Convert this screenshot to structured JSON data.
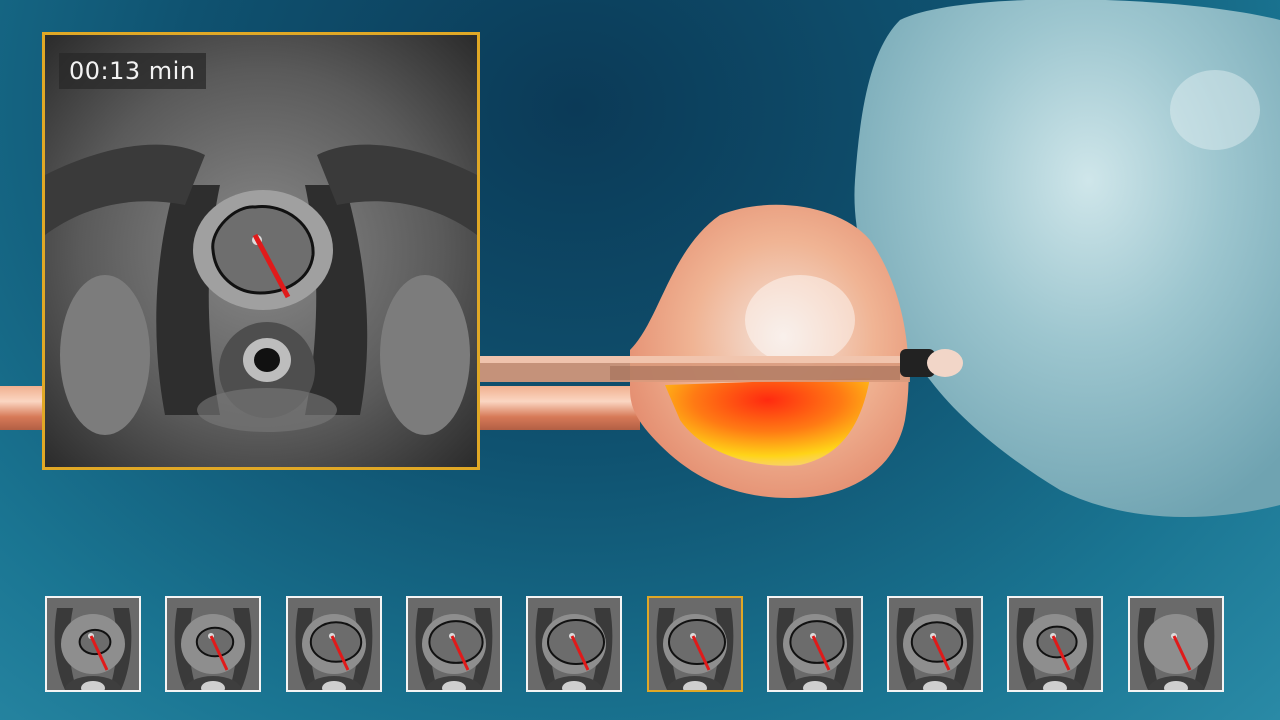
{
  "timer": {
    "label": "00:13 min"
  },
  "colors": {
    "background": "#0f5270",
    "highlight_border": "#e0a826",
    "thumbnail_border": "#f4f4f4",
    "applicator": "#e27b5a",
    "heat_core": "#ff3a10",
    "heat_edge": "#ffd21a",
    "bladder": "#9ec7cf"
  },
  "thumbnails": {
    "count": 10,
    "active_index": 5
  }
}
